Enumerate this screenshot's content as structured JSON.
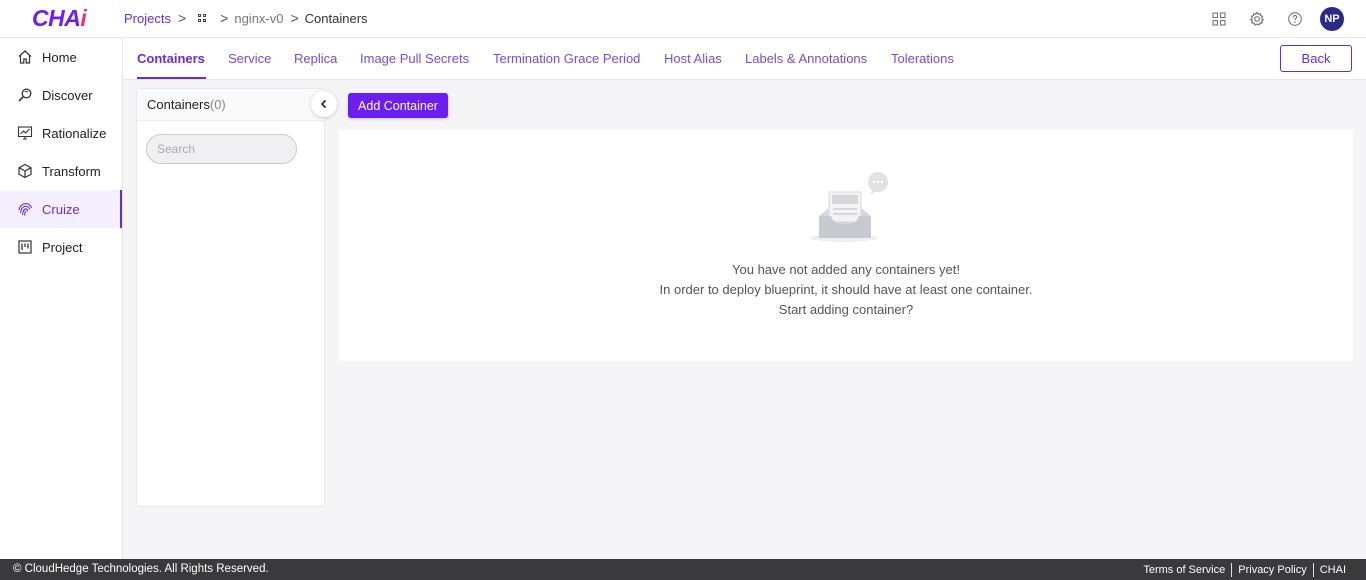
{
  "app": {
    "logo": "CHAI"
  },
  "breadcrumb": {
    "projects": "Projects",
    "project_name": "nginx-v0",
    "current": "Containers"
  },
  "header": {
    "avatar_initials": "NP",
    "icons": [
      "apps-grid-icon",
      "settings-icon",
      "help-icon"
    ]
  },
  "sidebar": {
    "items": [
      {
        "label": "Home",
        "icon": "home-icon"
      },
      {
        "label": "Discover",
        "icon": "discover-icon"
      },
      {
        "label": "Rationalize",
        "icon": "rationalize-icon"
      },
      {
        "label": "Transform",
        "icon": "cube-icon"
      },
      {
        "label": "Cruize",
        "icon": "fingerprint-icon",
        "active": true
      },
      {
        "label": "Project",
        "icon": "board-icon"
      }
    ]
  },
  "tabs": [
    {
      "label": "Containers",
      "active": true
    },
    {
      "label": "Service"
    },
    {
      "label": "Replica"
    },
    {
      "label": "Image Pull Secrets"
    },
    {
      "label": "Termination Grace Period"
    },
    {
      "label": "Host Alias"
    },
    {
      "label": "Labels & Annotations"
    },
    {
      "label": "Tolerations"
    }
  ],
  "back_label": "Back",
  "containers_panel": {
    "title": "Containers",
    "count": "(0)",
    "search_placeholder": "Search"
  },
  "add_container_label": "Add Container",
  "empty_state": {
    "line1": "You have not added any containers yet!",
    "line2": "In order to deploy blueprint, it should have at least one container.",
    "line3": "Start adding container?"
  },
  "footer": {
    "copyright": "© CloudHedge Technologies. All Rights Reserved.",
    "terms": "Terms of Service",
    "privacy": "Privacy Policy",
    "brand": "CHAI"
  },
  "colors": {
    "accent": "#6c2bd9",
    "button": "#6c1ef0",
    "footer_bg": "#3a3a3c",
    "avatar_bg": "#2a2a8c"
  }
}
